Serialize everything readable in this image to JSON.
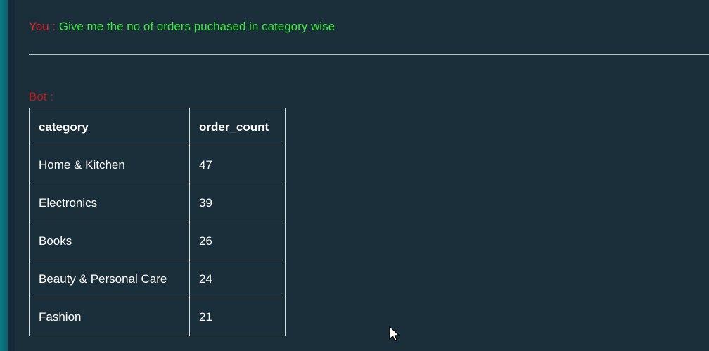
{
  "user": {
    "speaker": "You :",
    "message": "Give me the no of orders puchased in category wise"
  },
  "bot": {
    "speaker": "Bot :"
  },
  "table": {
    "headers": [
      "category",
      "order_count"
    ],
    "rows": [
      [
        "Home & Kitchen",
        "47"
      ],
      [
        "Electronics",
        "39"
      ],
      [
        "Books",
        "26"
      ],
      [
        "Beauty & Personal Care",
        "24"
      ],
      [
        "Fashion",
        "21"
      ]
    ]
  },
  "colors": {
    "background": "#1a2f3a",
    "speaker": "#d92626",
    "user_message": "#3ee63e",
    "table_text": "#ffffff"
  },
  "icons": {
    "cursor": "mouse-pointer-icon"
  }
}
